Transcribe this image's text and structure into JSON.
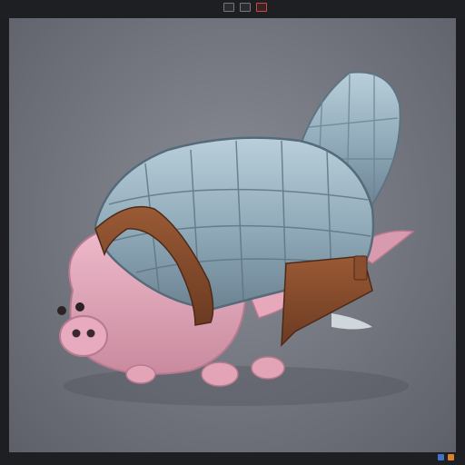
{
  "window": {
    "title": ""
  },
  "toolbar": {
    "icons": [
      "image-icon",
      "file-icon",
      "close-icon"
    ]
  },
  "scene": {
    "subject": "pig-armadillo-creature",
    "background_color": "#767982"
  },
  "statusbar": {
    "icons": [
      "windows-icon",
      "app-icon"
    ],
    "text": ""
  }
}
